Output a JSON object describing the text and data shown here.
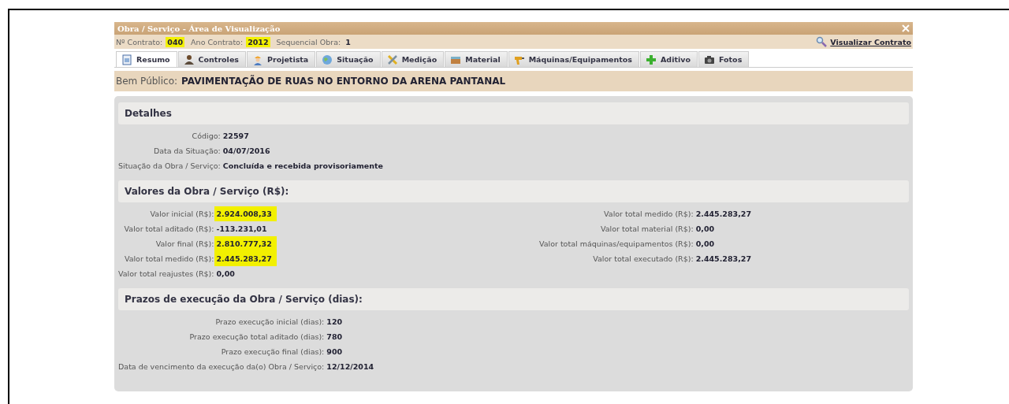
{
  "window": {
    "title": "Obra / Serviço - Área de Visualização"
  },
  "contract_bar": {
    "fields": [
      {
        "label": "Nº Contrato:",
        "value": "040",
        "highlighted": true
      },
      {
        "label": "Ano Contrato:",
        "value": "2012",
        "highlighted": true
      },
      {
        "label": "Sequencial Obra:",
        "value": "1",
        "highlighted": false
      }
    ],
    "link": "Visualizar Contrato"
  },
  "tabs": [
    {
      "label": "Resumo",
      "selected": true
    },
    {
      "label": "Controles",
      "selected": false
    },
    {
      "label": "Projetista",
      "selected": false
    },
    {
      "label": "Situação",
      "selected": false
    },
    {
      "label": "Medição",
      "selected": false
    },
    {
      "label": "Material",
      "selected": false
    },
    {
      "label": "Máquinas/Equipamentos",
      "selected": false
    },
    {
      "label": "Aditivo",
      "selected": false
    },
    {
      "label": "Fotos",
      "selected": false
    }
  ],
  "bem_publico": {
    "label": "Bem Público:",
    "value": "PAVIMENTAÇÃO DE RUAS NO ENTORNO DA ARENA PANTANAL"
  },
  "sections": [
    {
      "title": "Detalhes",
      "columns": [
        [
          {
            "label": "Código:",
            "value": "22597",
            "highlighted": false
          },
          {
            "label": "Data da Situação:",
            "value": "04/07/2016",
            "highlighted": false
          },
          {
            "label": "Situação da Obra / Serviço:",
            "value": "Concluída e recebida provisoriamente",
            "highlighted": false
          }
        ]
      ]
    },
    {
      "title": "Valores da Obra / Serviço (R$):",
      "columns": [
        [
          {
            "label": "Valor inicial (R$):",
            "value": "2.924.008,33",
            "highlighted": true
          },
          {
            "label": "Valor total aditado (R$):",
            "value": "-113.231,01",
            "highlighted": false
          },
          {
            "label": "Valor final (R$):",
            "value": "2.810.777,32",
            "highlighted": true
          },
          {
            "label": "Valor total medido (R$):",
            "value": "2.445.283,27",
            "highlighted": true
          },
          {
            "label": "Valor total reajustes (R$):",
            "value": "0,00",
            "highlighted": false
          }
        ],
        [
          {
            "label": "Valor total medido (R$):",
            "value": "2.445.283,27",
            "highlighted": false
          },
          {
            "label": "Valor total material (R$):",
            "value": "0,00",
            "highlighted": false
          },
          {
            "label": "Valor total máquinas/equipamentos (R$):",
            "value": "0,00",
            "highlighted": false
          },
          {
            "label": "Valor total executado (R$):",
            "value": "2.445.283,27",
            "highlighted": false
          }
        ]
      ]
    },
    {
      "title": "Prazos de execução da Obra / Serviço (dias):",
      "columns": [
        [
          {
            "label": "Prazo execução inicial (dias):",
            "value": "120",
            "highlighted": false
          },
          {
            "label": "Prazo execução total aditado (dias):",
            "value": "780",
            "highlighted": false
          },
          {
            "label": "Prazo execução final (dias):",
            "value": "900",
            "highlighted": false
          },
          {
            "label": "Data de vencimento da execução da(o) Obra / Serviço:",
            "value": "12/12/2014",
            "highlighted": false
          }
        ]
      ]
    }
  ]
}
